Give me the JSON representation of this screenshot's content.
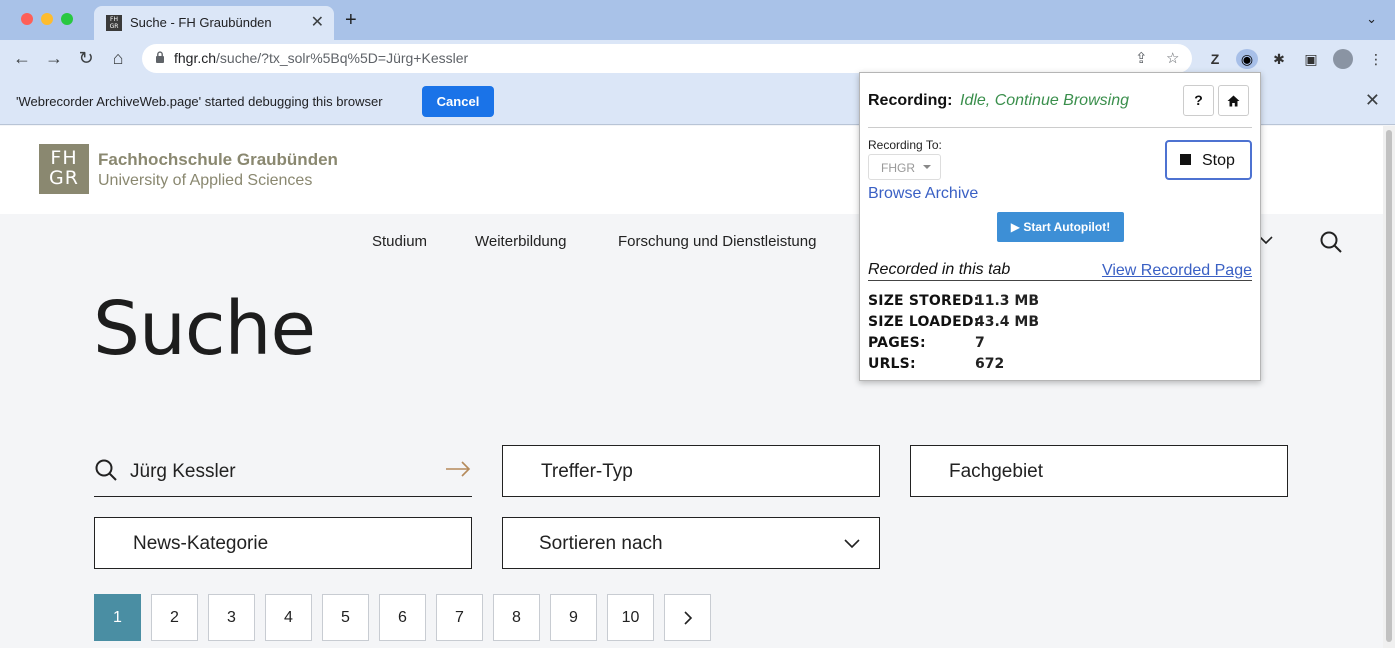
{
  "browser": {
    "tab": {
      "title": "Suche - FH Graubünden",
      "favicon_text": "FH GR"
    },
    "url": {
      "host": "fhgr.ch",
      "path": "/suche/?tx_solr%5Bq%5D=Jürg+Kessler"
    },
    "icons": [
      "back-icon",
      "forward-icon",
      "reload-icon",
      "home-icon",
      "lock-icon",
      "share-icon",
      "bookmark-star-icon",
      "zotero-icon",
      "webrecorder-icon",
      "puzzle-icon",
      "sidepanel-icon",
      "profile-avatar",
      "more-icon"
    ]
  },
  "infobar": {
    "message": "'Webrecorder ArchiveWeb.page' started debugging this browser",
    "cancel_label": "Cancel"
  },
  "site": {
    "logo_text": "FH GR",
    "name": "Fachhochschule Graubünden",
    "subtitle": "University of Applied Sciences",
    "nav": [
      "Studium",
      "Weiterbildung",
      "Forschung und Dienstleistung"
    ]
  },
  "search_page": {
    "title": "Suche",
    "query": "Jürg Kessler",
    "filters": {
      "type": "Treffer-Typ",
      "field": "Fachgebiet",
      "news": "News-Kategorie",
      "sort": "Sortieren nach"
    },
    "pagination": [
      "1",
      "2",
      "3",
      "4",
      "5",
      "6",
      "7",
      "8",
      "9",
      "10"
    ],
    "current_page": "1"
  },
  "popup": {
    "recording_label": "Recording:",
    "recording_status": "Idle, Continue Browsing",
    "help_label": "?",
    "home_label": "⌂",
    "recording_to_label": "Recording To:",
    "collection": "FHGR",
    "stop_label": "Stop",
    "browse_archive": "Browse Archive",
    "autopilot_label": "▶ Start Autopilot!",
    "recorded_tab_label": "Recorded in this tab",
    "view_recorded": "View Recorded Page",
    "stats": {
      "size_stored_label": "SIZE STORED:",
      "size_stored": "11.3 MB",
      "size_loaded_label": "SIZE LOADED:",
      "size_loaded": "43.4 MB",
      "pages_label": "PAGES:",
      "pages": "7",
      "urls_label": "URLS:",
      "urls": "672"
    }
  }
}
